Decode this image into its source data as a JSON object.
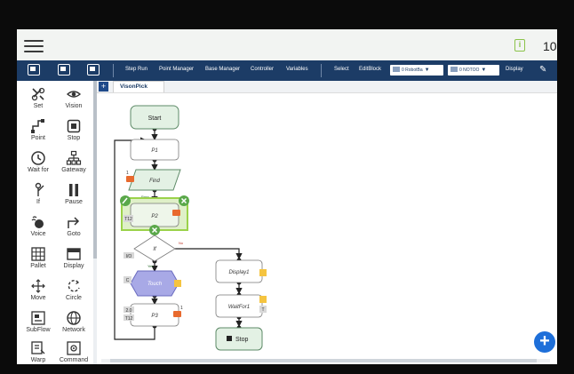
{
  "status": {
    "value": "10"
  },
  "toolbar": {
    "items": [
      "Step Run",
      "Point Manager",
      "Base Manager",
      "Controller",
      "Variables",
      "Select",
      "EditBlock"
    ],
    "robot_dropdown": "0 RobotBa",
    "tool_dropdown": "0 NOTOO",
    "display": "Display"
  },
  "sidebar": {
    "tools": [
      {
        "label": "Set",
        "icon": "wrench-icon"
      },
      {
        "label": "Vision",
        "icon": "eye-icon"
      },
      {
        "label": "Point",
        "icon": "point-icon"
      },
      {
        "label": "Stop",
        "icon": "stop-icon"
      },
      {
        "label": "Wait for",
        "icon": "clock-icon"
      },
      {
        "label": "Gateway",
        "icon": "gateway-icon"
      },
      {
        "label": "If",
        "icon": "branch-icon"
      },
      {
        "label": "Pause",
        "icon": "pause-icon"
      },
      {
        "label": "Voice",
        "icon": "voice-icon"
      },
      {
        "label": "Goto",
        "icon": "goto-arrow-icon"
      },
      {
        "label": "Pallet",
        "icon": "pallet-grid-icon"
      },
      {
        "label": "Display",
        "icon": "display-icon"
      },
      {
        "label": "Move",
        "icon": "move-icon"
      },
      {
        "label": "Circle",
        "icon": "circle-icon"
      },
      {
        "label": "SubFlow",
        "icon": "subflow-icon"
      },
      {
        "label": "Network",
        "icon": "globe-icon"
      },
      {
        "label": "Warp",
        "icon": "warp-icon"
      },
      {
        "label": "Command",
        "icon": "command-icon"
      }
    ]
  },
  "tabs": {
    "active": "VisonPick"
  },
  "flow": {
    "nodes": {
      "start": "Start",
      "p1": "P1",
      "find": "Find",
      "p2": "P2",
      "if": "If",
      "touch": "Touch",
      "p3": "P3",
      "display1": "Display1",
      "waitfor1": "WaitFor1",
      "stop": "Stop"
    },
    "tags": {
      "find_num": "1",
      "p2_tag": "T12",
      "if_tag": "I/O",
      "touch_tag": "C",
      "p3_tag1": "2.0",
      "p3_tag2": "T12",
      "p3_num": "1",
      "waitfor_tag": "T"
    },
    "labels": {
      "pass": "Pass",
      "yes": "Yes",
      "no": "No"
    }
  },
  "colors": {
    "toolbar": "#1c3c66",
    "node_green": "#e3f1e4",
    "node_border": "#5d8a67",
    "touch_fill": "#a8a9e6",
    "selection": "#9bd24a",
    "fab": "#1e6fd9",
    "camera_badge": "#e86a2e",
    "note_badge": "#f5c440"
  }
}
